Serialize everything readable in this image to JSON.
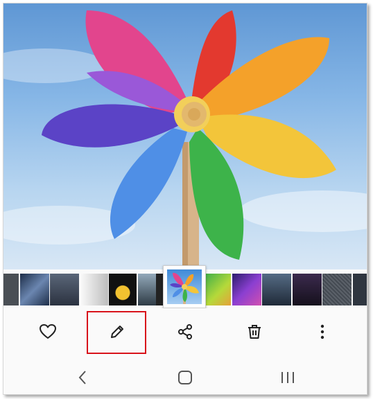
{
  "photo": {
    "subject": "pinwheel",
    "sky_colors": [
      "#5f97d4",
      "#d8e7f5"
    ]
  },
  "filmstrip": {
    "thumbnails": [
      {
        "name": "thumb-1",
        "color": "#4a4f55"
      },
      {
        "name": "thumb-2",
        "color": "#2c3f5a"
      },
      {
        "name": "thumb-3",
        "color": "#3d4655"
      },
      {
        "name": "thumb-4",
        "color": "#d9d9d9"
      },
      {
        "name": "thumb-5",
        "color": "#1a1a1a"
      },
      {
        "name": "thumb-6",
        "color": "#3c5160"
      },
      {
        "name": "thumb-8",
        "color": "#7fbf3f"
      },
      {
        "name": "thumb-9",
        "color": "#4a2c8f"
      },
      {
        "name": "thumb-10",
        "color": "#3d5066"
      },
      {
        "name": "thumb-11",
        "color": "#2a2033"
      },
      {
        "name": "thumb-12",
        "color": "#555b63"
      },
      {
        "name": "thumb-13",
        "color": "#333a44"
      }
    ],
    "selected": "thumb-7"
  },
  "actions": [
    {
      "name": "favorite-button",
      "icon": "heart-icon"
    },
    {
      "name": "edit-button",
      "icon": "pencil-icon"
    },
    {
      "name": "share-button",
      "icon": "share-icon"
    },
    {
      "name": "delete-button",
      "icon": "trash-icon"
    },
    {
      "name": "more-button",
      "icon": "more-vertical-icon"
    }
  ],
  "highlight": {
    "target": "edit-button",
    "color": "#d8121a"
  },
  "navigation": [
    {
      "name": "back-nav-button",
      "icon": "chevron-left-icon"
    },
    {
      "name": "home-nav-button",
      "icon": "home-square-icon"
    },
    {
      "name": "recents-nav-button",
      "icon": "recents-icon"
    }
  ]
}
